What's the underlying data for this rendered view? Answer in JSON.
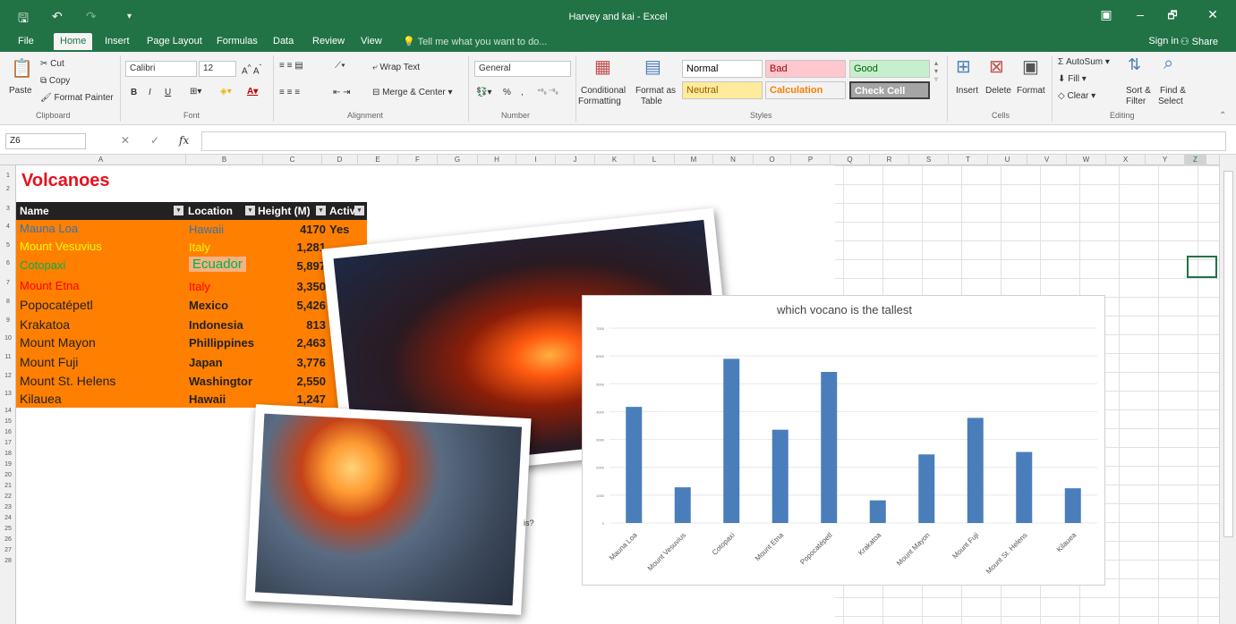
{
  "window": {
    "title": "Harvey and kai - Excel",
    "qat_save_icon": "save-icon",
    "qat_undo_icon": "undo-icon",
    "qat_redo_icon": "redo-icon",
    "min": "–",
    "max": "🗗",
    "close": "✕"
  },
  "tabs": [
    "File",
    "Home",
    "Insert",
    "Page Layout",
    "Formulas",
    "Data",
    "Review",
    "View"
  ],
  "tell_me": "Tell me what you want to do...",
  "sign_in": "Sign in",
  "share": "Share",
  "ribbon": {
    "clipboard": {
      "paste": "Paste",
      "cut": "Cut",
      "copy": "Copy",
      "format_painter": "Format Painter",
      "group": "Clipboard"
    },
    "font": {
      "name": "Calibri",
      "size": "12",
      "group": "Font",
      "bold": "B",
      "italic": "I",
      "underline": "U"
    },
    "alignment": {
      "wrap": "Wrap Text",
      "merge": "Merge & Center",
      "group": "Alignment"
    },
    "number": {
      "format": "General",
      "percent": "%",
      "comma": ",",
      "group": "Number"
    },
    "styles": {
      "conditional": "Conditional",
      "conditional2": "Formatting",
      "format_as": "Format as",
      "format_as2": "Table",
      "normal": "Normal",
      "bad": "Bad",
      "good": "Good",
      "neutral": "Neutral",
      "calculation": "Calculation",
      "check_cell": "Check Cell",
      "group": "Styles"
    },
    "cells": {
      "insert": "Insert",
      "delete": "Delete",
      "format": "Format",
      "group": "Cells"
    },
    "editing": {
      "autosum": "AutoSum",
      "fill": "Fill",
      "clear": "Clear",
      "sort": "Sort &",
      "sort2": "Filter",
      "find": "Find &",
      "find2": "Select",
      "group": "Editing"
    }
  },
  "formula_bar": {
    "name_box": "Z6",
    "fx": "fx",
    "value": ""
  },
  "columns": [
    "A",
    "B",
    "C",
    "D",
    "E",
    "F",
    "G",
    "H",
    "I",
    "J",
    "K",
    "L",
    "M",
    "N",
    "O",
    "P",
    "Q",
    "R",
    "S",
    "T",
    "U",
    "V",
    "W",
    "X",
    "Y",
    "Z"
  ],
  "rows": [
    "1",
    "2",
    "3",
    "4",
    "5",
    "6",
    "7",
    "8",
    "9",
    "10",
    "11",
    "12",
    "13",
    "14",
    "15",
    "16",
    "17",
    "18",
    "19",
    "20",
    "21",
    "22",
    "23",
    "24",
    "25",
    "26",
    "27",
    "28"
  ],
  "sheet": {
    "title": "Volcanoes",
    "headers": [
      "Name",
      "Location",
      "Height (M)",
      "Activ"
    ],
    "rows": [
      {
        "name": "Mauna Loa",
        "location": "Hawaii",
        "height": "4170",
        "active": "Yes",
        "color": "#2f75b5",
        "loc_color": "#2f75b5"
      },
      {
        "name": "Mount Vesuvius",
        "location": "Italy",
        "height": "1,281",
        "active": "",
        "color": "#ffff00",
        "loc_color": "#ffff00"
      },
      {
        "name": "Cotopaxi",
        "location": "Ecuador",
        "height": "5,897",
        "active": "",
        "color": "#00b050",
        "loc_color": "#00b050"
      },
      {
        "name": "Mount Etna",
        "location": "Italy",
        "height": "3,350",
        "active": "",
        "color": "#ff0000",
        "loc_color": "#ff0000"
      },
      {
        "name": "Popocatépetl",
        "location": "Mexico",
        "height": "5,426",
        "active": "",
        "color": "#222222",
        "loc_color": "#222222"
      },
      {
        "name": "Krakatoa",
        "location": "Indonesia",
        "height": "813",
        "active": "",
        "color": "#222222",
        "loc_color": "#222222"
      },
      {
        "name": "Mount Mayon",
        "location": "Phillippines",
        "height": "2,463",
        "active": "",
        "color": "#222222",
        "loc_color": "#222222"
      },
      {
        "name": "Mount Fuji",
        "location": "Japan",
        "height": "3,776",
        "active": "",
        "color": "#222222",
        "loc_color": "#222222"
      },
      {
        "name": "Mount St. Helens",
        "location": "Washingtor",
        "height": "2,550",
        "active": "",
        "color": "#222222",
        "loc_color": "#222222"
      },
      {
        "name": "Kilauea",
        "location": "Hawaii",
        "height": "1,247",
        "active": "",
        "color": "#222222",
        "loc_color": "#222222"
      }
    ],
    "stray_text": "is?"
  },
  "chart_data": {
    "type": "bar",
    "title": "which vocano is the tallest",
    "categories": [
      "Mauna Loa",
      "Mount Vesuvius",
      "Cotopaxi",
      "Mount Etna",
      "Popocatépetl",
      "Krakatoa",
      "Mount Mayon",
      "Mount Fuji",
      "Mount St. Helens",
      "Kilauea"
    ],
    "values": [
      4170,
      1281,
      5897,
      3350,
      5426,
      813,
      2463,
      3776,
      2550,
      1247
    ],
    "yticks": [
      "0",
      "1000",
      "2000",
      "3000",
      "4000",
      "5000",
      "6000",
      "7000"
    ],
    "ylim": [
      0,
      7000
    ],
    "bar_color": "#4a7ebb"
  }
}
